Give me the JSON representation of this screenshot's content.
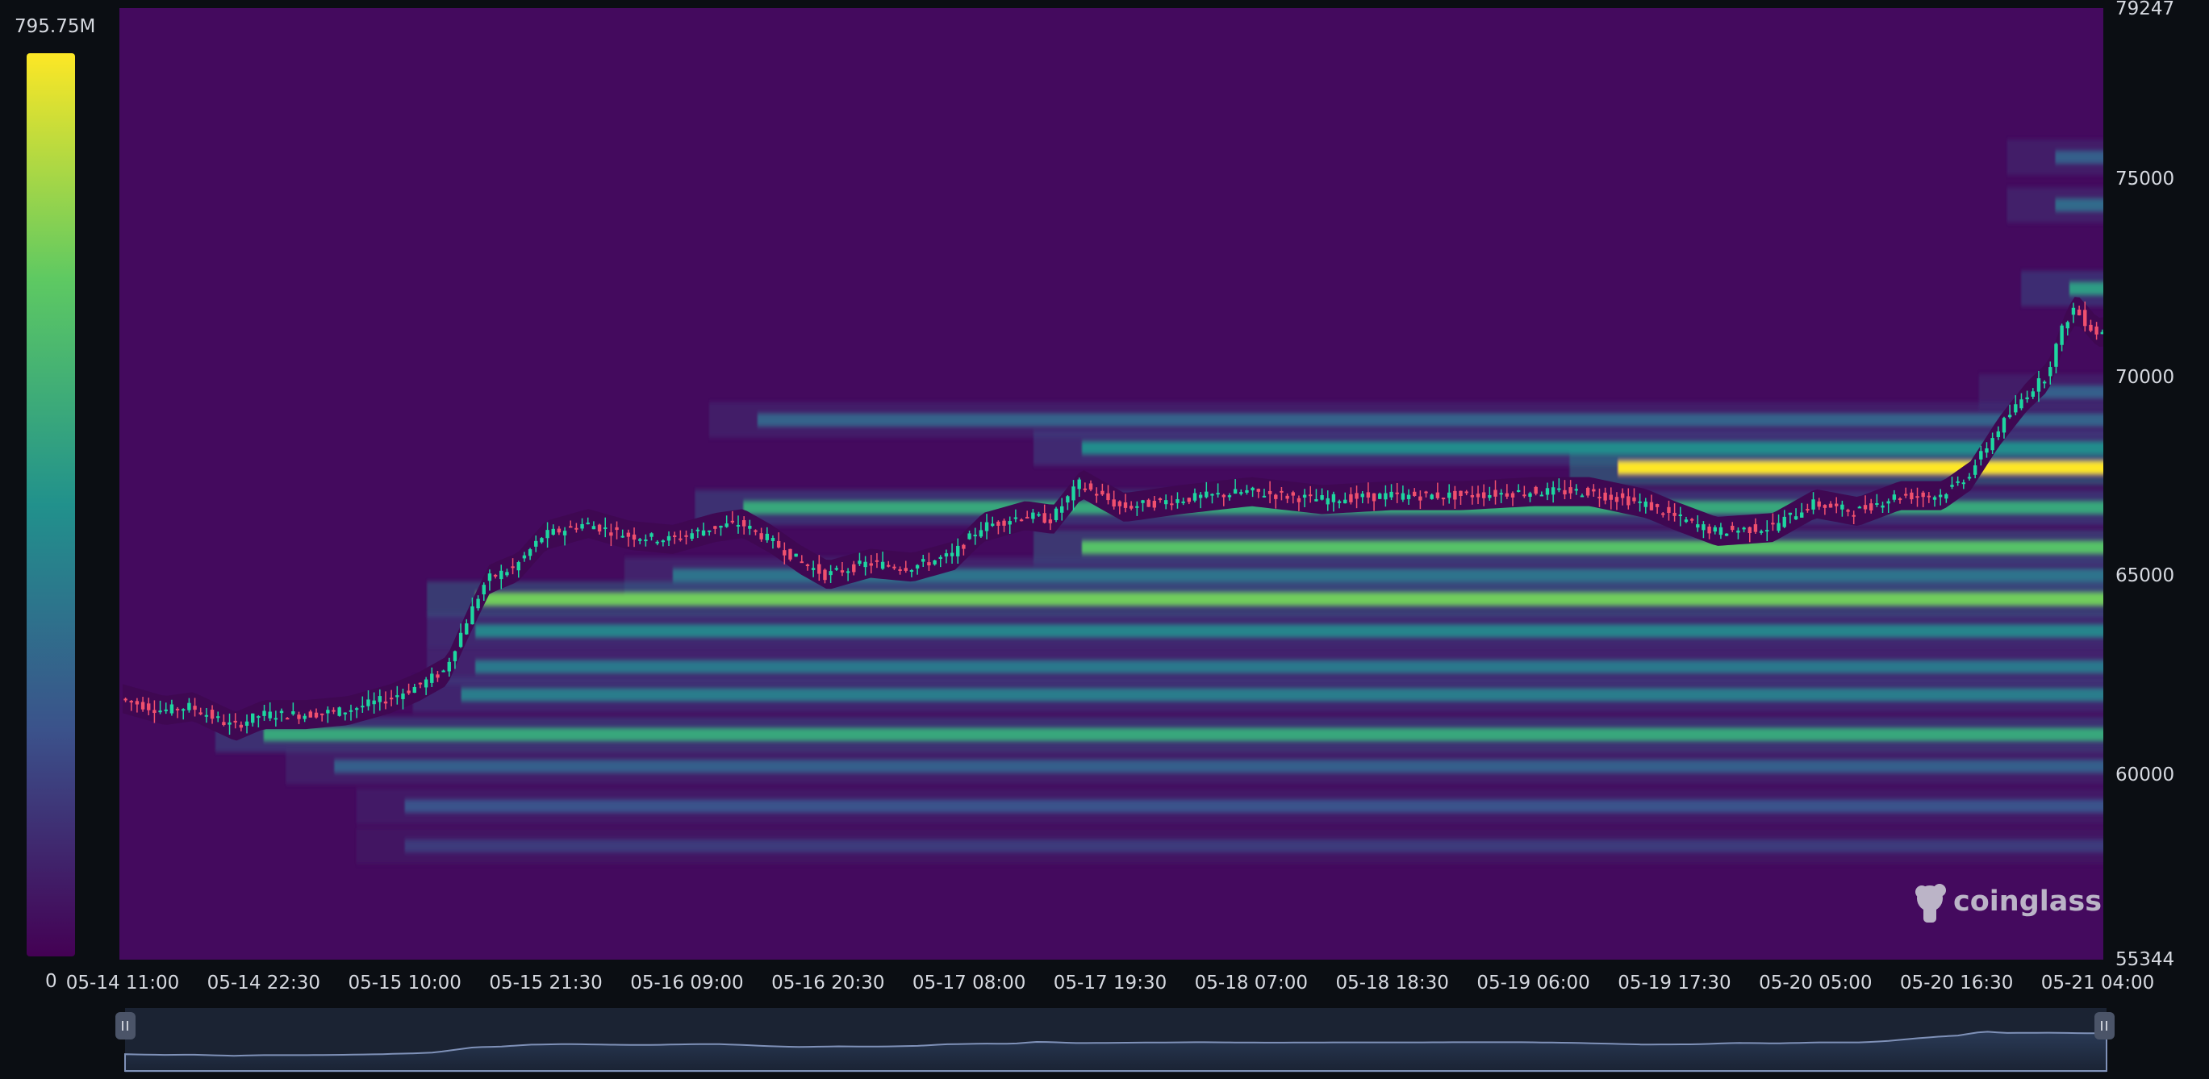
{
  "chart_data": {
    "type": "heatmap",
    "title": "",
    "xlabel": "",
    "ylabel": "",
    "overlay": "candlestick",
    "colorbar": {
      "max_label": "795.75M",
      "min_label": "0",
      "max": 795750000,
      "min": 0,
      "colormap": "viridis"
    },
    "y_axis": {
      "position": "right",
      "range": [
        55344,
        79247
      ],
      "top_label": "79247",
      "bottom_label": "55344",
      "ticks": [
        "75000",
        "70000",
        "65000",
        "60000"
      ]
    },
    "x_axis": {
      "ticks": [
        "05-14 11:00",
        "05-14 22:30",
        "05-15 10:00",
        "05-15 21:30",
        "05-16 09:00",
        "05-16 20:30",
        "05-17 08:00",
        "05-17 19:30",
        "05-18 07:00",
        "05-18 18:30",
        "05-19 06:00",
        "05-19 17:30",
        "05-20 05:00",
        "05-20 16:30",
        "05-21 04:00"
      ]
    },
    "price_path": [
      {
        "t": 0,
        "p": 61900
      },
      {
        "t": 0.3,
        "p": 61600
      },
      {
        "t": 0.5,
        "p": 61700
      },
      {
        "t": 0.8,
        "p": 61200
      },
      {
        "t": 1.0,
        "p": 61500
      },
      {
        "t": 1.3,
        "p": 61500
      },
      {
        "t": 1.6,
        "p": 61600
      },
      {
        "t": 1.9,
        "p": 61900
      },
      {
        "t": 2.1,
        "p": 62200
      },
      {
        "t": 2.3,
        "p": 62600
      },
      {
        "t": 2.45,
        "p": 63800
      },
      {
        "t": 2.6,
        "p": 64900
      },
      {
        "t": 2.8,
        "p": 65200
      },
      {
        "t": 3.0,
        "p": 66000
      },
      {
        "t": 3.3,
        "p": 66300
      },
      {
        "t": 3.6,
        "p": 66000
      },
      {
        "t": 3.9,
        "p": 65900
      },
      {
        "t": 4.2,
        "p": 66200
      },
      {
        "t": 4.4,
        "p": 66300
      },
      {
        "t": 4.6,
        "p": 65900
      },
      {
        "t": 4.8,
        "p": 65400
      },
      {
        "t": 5.0,
        "p": 65000
      },
      {
        "t": 5.3,
        "p": 65300
      },
      {
        "t": 5.6,
        "p": 65200
      },
      {
        "t": 5.9,
        "p": 65500
      },
      {
        "t": 6.1,
        "p": 66200
      },
      {
        "t": 6.4,
        "p": 66500
      },
      {
        "t": 6.6,
        "p": 66400
      },
      {
        "t": 6.8,
        "p": 67300
      },
      {
        "t": 7.1,
        "p": 66700
      },
      {
        "t": 7.5,
        "p": 66900
      },
      {
        "t": 8.0,
        "p": 67100
      },
      {
        "t": 8.5,
        "p": 66900
      },
      {
        "t": 9.0,
        "p": 67000
      },
      {
        "t": 9.5,
        "p": 67000
      },
      {
        "t": 10.0,
        "p": 67100
      },
      {
        "t": 10.4,
        "p": 67100
      },
      {
        "t": 10.8,
        "p": 66800
      },
      {
        "t": 11.0,
        "p": 66500
      },
      {
        "t": 11.3,
        "p": 66100
      },
      {
        "t": 11.7,
        "p": 66200
      },
      {
        "t": 12.0,
        "p": 66800
      },
      {
        "t": 12.3,
        "p": 66600
      },
      {
        "t": 12.6,
        "p": 67000
      },
      {
        "t": 12.9,
        "p": 67000
      },
      {
        "t": 13.1,
        "p": 67500
      },
      {
        "t": 13.3,
        "p": 68600
      },
      {
        "t": 13.5,
        "p": 69500
      },
      {
        "t": 13.65,
        "p": 70000
      },
      {
        "t": 13.78,
        "p": 71300
      },
      {
        "t": 13.85,
        "p": 71700
      },
      {
        "t": 14.0,
        "p": 71100
      },
      {
        "t": 14.3,
        "p": 71200
      },
      {
        "t": 14.6,
        "p": 71000
      },
      {
        "t": 14.75,
        "p": 71000
      }
    ],
    "liquidity_bands": [
      {
        "price": 72200,
        "start": 13.8,
        "intensity": 0.55
      },
      {
        "price": 74300,
        "start": 13.7,
        "intensity": 0.35
      },
      {
        "price": 75500,
        "start": 13.7,
        "intensity": 0.3
      },
      {
        "price": 69600,
        "start": 13.5,
        "intensity": 0.3
      },
      {
        "price": 68900,
        "start": 4.5,
        "intensity": 0.32
      },
      {
        "price": 68200,
        "start": 6.8,
        "intensity": 0.48
      },
      {
        "price": 67700,
        "start": 10.6,
        "intensity": 1.0
      },
      {
        "price": 66700,
        "start": 4.4,
        "intensity": 0.6
      },
      {
        "price": 65700,
        "start": 6.8,
        "intensity": 0.72
      },
      {
        "price": 65000,
        "start": 3.9,
        "intensity": 0.38
      },
      {
        "price": 64400,
        "start": 2.5,
        "intensity": 0.78
      },
      {
        "price": 63600,
        "start": 2.5,
        "intensity": 0.45
      },
      {
        "price": 62700,
        "start": 2.5,
        "intensity": 0.4
      },
      {
        "price": 62000,
        "start": 2.4,
        "intensity": 0.42
      },
      {
        "price": 61000,
        "start": 1.0,
        "intensity": 0.6
      },
      {
        "price": 60200,
        "start": 1.5,
        "intensity": 0.3
      },
      {
        "price": 59200,
        "start": 2.0,
        "intensity": 0.25
      },
      {
        "price": 58200,
        "start": 2.0,
        "intensity": 0.18
      }
    ],
    "colors": {
      "up": "#1ed6a0",
      "down": "#f0506e",
      "background_heat": "#440a5e",
      "peak_heat": "#fde725"
    }
  },
  "watermark": {
    "text": "coinglass"
  }
}
